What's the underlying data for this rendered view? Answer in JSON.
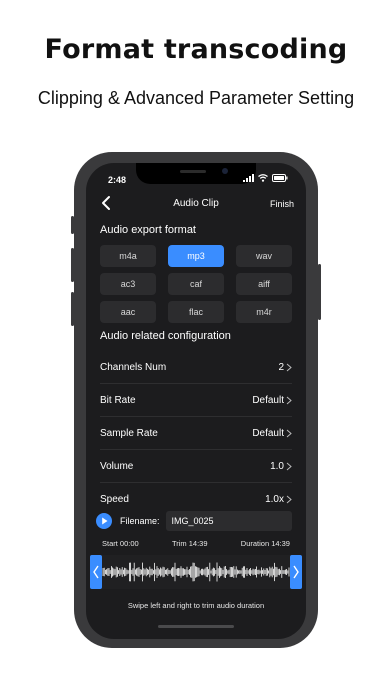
{
  "headline": "Format transcoding",
  "subheadline": "Clipping & Advanced Parameter Setting",
  "status_bar": {
    "time": "2:48",
    "icons": [
      "signal-icon",
      "wifi-icon",
      "battery-icon"
    ]
  },
  "nav": {
    "title": "Audio Clip",
    "finish_label": "Finish",
    "back_icon": "chevron-left-icon"
  },
  "export_format": {
    "heading": "Audio export format",
    "selected": "mp3",
    "options": [
      "m4a",
      "mp3",
      "wav",
      "ac3",
      "caf",
      "aiff",
      "aac",
      "flac",
      "m4r"
    ]
  },
  "config": {
    "heading": "Audio related configuration",
    "rows": [
      {
        "label": "Channels Num",
        "value": "2"
      },
      {
        "label": "Bit Rate",
        "value": "Default"
      },
      {
        "label": "Sample Rate",
        "value": "Default"
      },
      {
        "label": "Volume",
        "value": "1.0"
      },
      {
        "label": "Speed",
        "value": "1.0x"
      }
    ]
  },
  "file": {
    "label": "Filename:",
    "value": "IMG_0025"
  },
  "trim": {
    "start": "Start 00:00",
    "trim": "Trim 14:39",
    "duration": "Duration 14:39"
  },
  "hint": "Swipe left and right to trim audio duration",
  "colors": {
    "accent": "#3a8dff",
    "screen_bg": "#1c1c1e",
    "control_bg": "#2c2c2e"
  }
}
